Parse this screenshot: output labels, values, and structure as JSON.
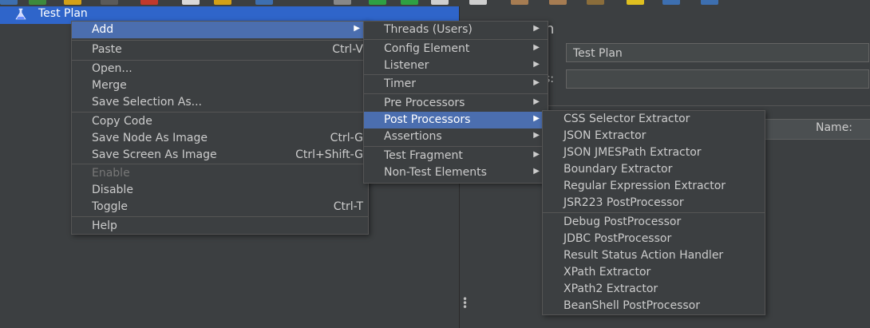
{
  "tree": {
    "selected_node": "Test Plan"
  },
  "right_panel": {
    "title_partial": "n",
    "name_value": "Test Plan",
    "comments_label_partial": "s:",
    "table_header_name": "Name:"
  },
  "context_menu": {
    "items": [
      {
        "label": "Add",
        "accel": "",
        "submenu": true,
        "highlight": true
      },
      {
        "label": "Paste",
        "accel": "Ctrl-V"
      },
      {
        "label": "Open...",
        "accel": ""
      },
      {
        "label": "Merge",
        "accel": ""
      },
      {
        "label": "Save Selection As...",
        "accel": ""
      },
      {
        "label": "Copy Code",
        "accel": ""
      },
      {
        "label": "Save Node As Image",
        "accel": "Ctrl-G"
      },
      {
        "label": "Save Screen As Image",
        "accel": "Ctrl+Shift-G"
      },
      {
        "label": "Enable",
        "accel": "",
        "disabled": true
      },
      {
        "label": "Disable",
        "accel": ""
      },
      {
        "label": "Toggle",
        "accel": "Ctrl-T"
      },
      {
        "label": "Help",
        "accel": ""
      }
    ]
  },
  "add_submenu": {
    "items": [
      {
        "label": "Threads (Users)"
      },
      {
        "label": "Config Element"
      },
      {
        "label": "Listener"
      },
      {
        "label": "Timer"
      },
      {
        "label": "Pre Processors"
      },
      {
        "label": "Post Processors",
        "highlight": true
      },
      {
        "label": "Assertions"
      },
      {
        "label": "Test Fragment"
      },
      {
        "label": "Non-Test Elements"
      }
    ]
  },
  "post_processors_submenu": {
    "items": [
      {
        "label": "CSS Selector Extractor"
      },
      {
        "label": "JSON Extractor"
      },
      {
        "label": "JSON JMESPath Extractor"
      },
      {
        "label": "Boundary Extractor"
      },
      {
        "label": "Regular Expression Extractor"
      },
      {
        "label": "JSR223 PostProcessor"
      },
      {
        "label": "Debug PostProcessor"
      },
      {
        "label": "JDBC PostProcessor"
      },
      {
        "label": "Result Status Action Handler"
      },
      {
        "label": "XPath Extractor"
      },
      {
        "label": "XPath2 Extractor"
      },
      {
        "label": "BeanShell PostProcessor"
      }
    ]
  },
  "colors": {
    "background": "#3c3f41",
    "selection": "#4b6eaf",
    "tree_selection": "#2f65ca"
  }
}
